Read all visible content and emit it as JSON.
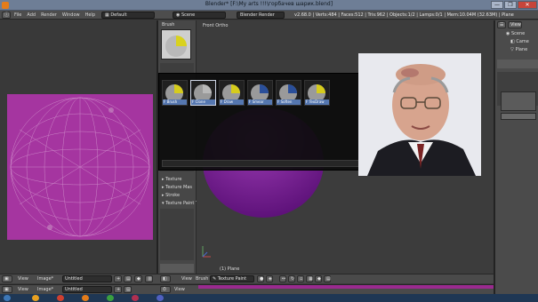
{
  "window": {
    "title": "Blender* [F:\\My arts !!!\\горбачев шарик.blend]",
    "controls": [
      "—",
      "❐",
      "✕"
    ]
  },
  "info_header": {
    "menu": [
      "File",
      "Add",
      "Render",
      "Window",
      "Help"
    ],
    "layout": "Default",
    "scene": "Scene",
    "engine": "Blender Render",
    "stats": "v2.68.0 | Verts:484 | Faces:512 | Tris:962 | Objects:1/2 | Lamps:0/1 | Mem:10.04M (32.63M) | Plane"
  },
  "toolshelf": {
    "brush_panel": "Brush",
    "sections": [
      "Texture",
      "Texture Mas",
      "Stroke",
      "Texture Paint To"
    ]
  },
  "viewport": {
    "mode_label": "Front Ortho",
    "object_label": "(1) Plane"
  },
  "brush_popup": {
    "brushes": [
      "F Brush",
      "F Clone",
      "F Draw",
      "F Smear",
      "F Soften",
      "F TexDraw"
    ],
    "active_index": 1
  },
  "uv_header": {
    "view": "View",
    "image": "Image*",
    "image_name": "Untitled"
  },
  "uv_header2": {
    "view": "View",
    "image": "Image*",
    "image_name": "Untitled"
  },
  "vp_header": {
    "view": "View",
    "brush": "Brush",
    "mode": "Texture Paint"
  },
  "vp_header2": {
    "view": "View"
  },
  "outliner": {
    "items": [
      "Scene",
      "Came",
      "Plane"
    ],
    "view": "View"
  },
  "colors": {
    "uv_purple": "#a535a0",
    "sphere_purple": "#7a1e92",
    "brush_caption": "#5577b0"
  }
}
